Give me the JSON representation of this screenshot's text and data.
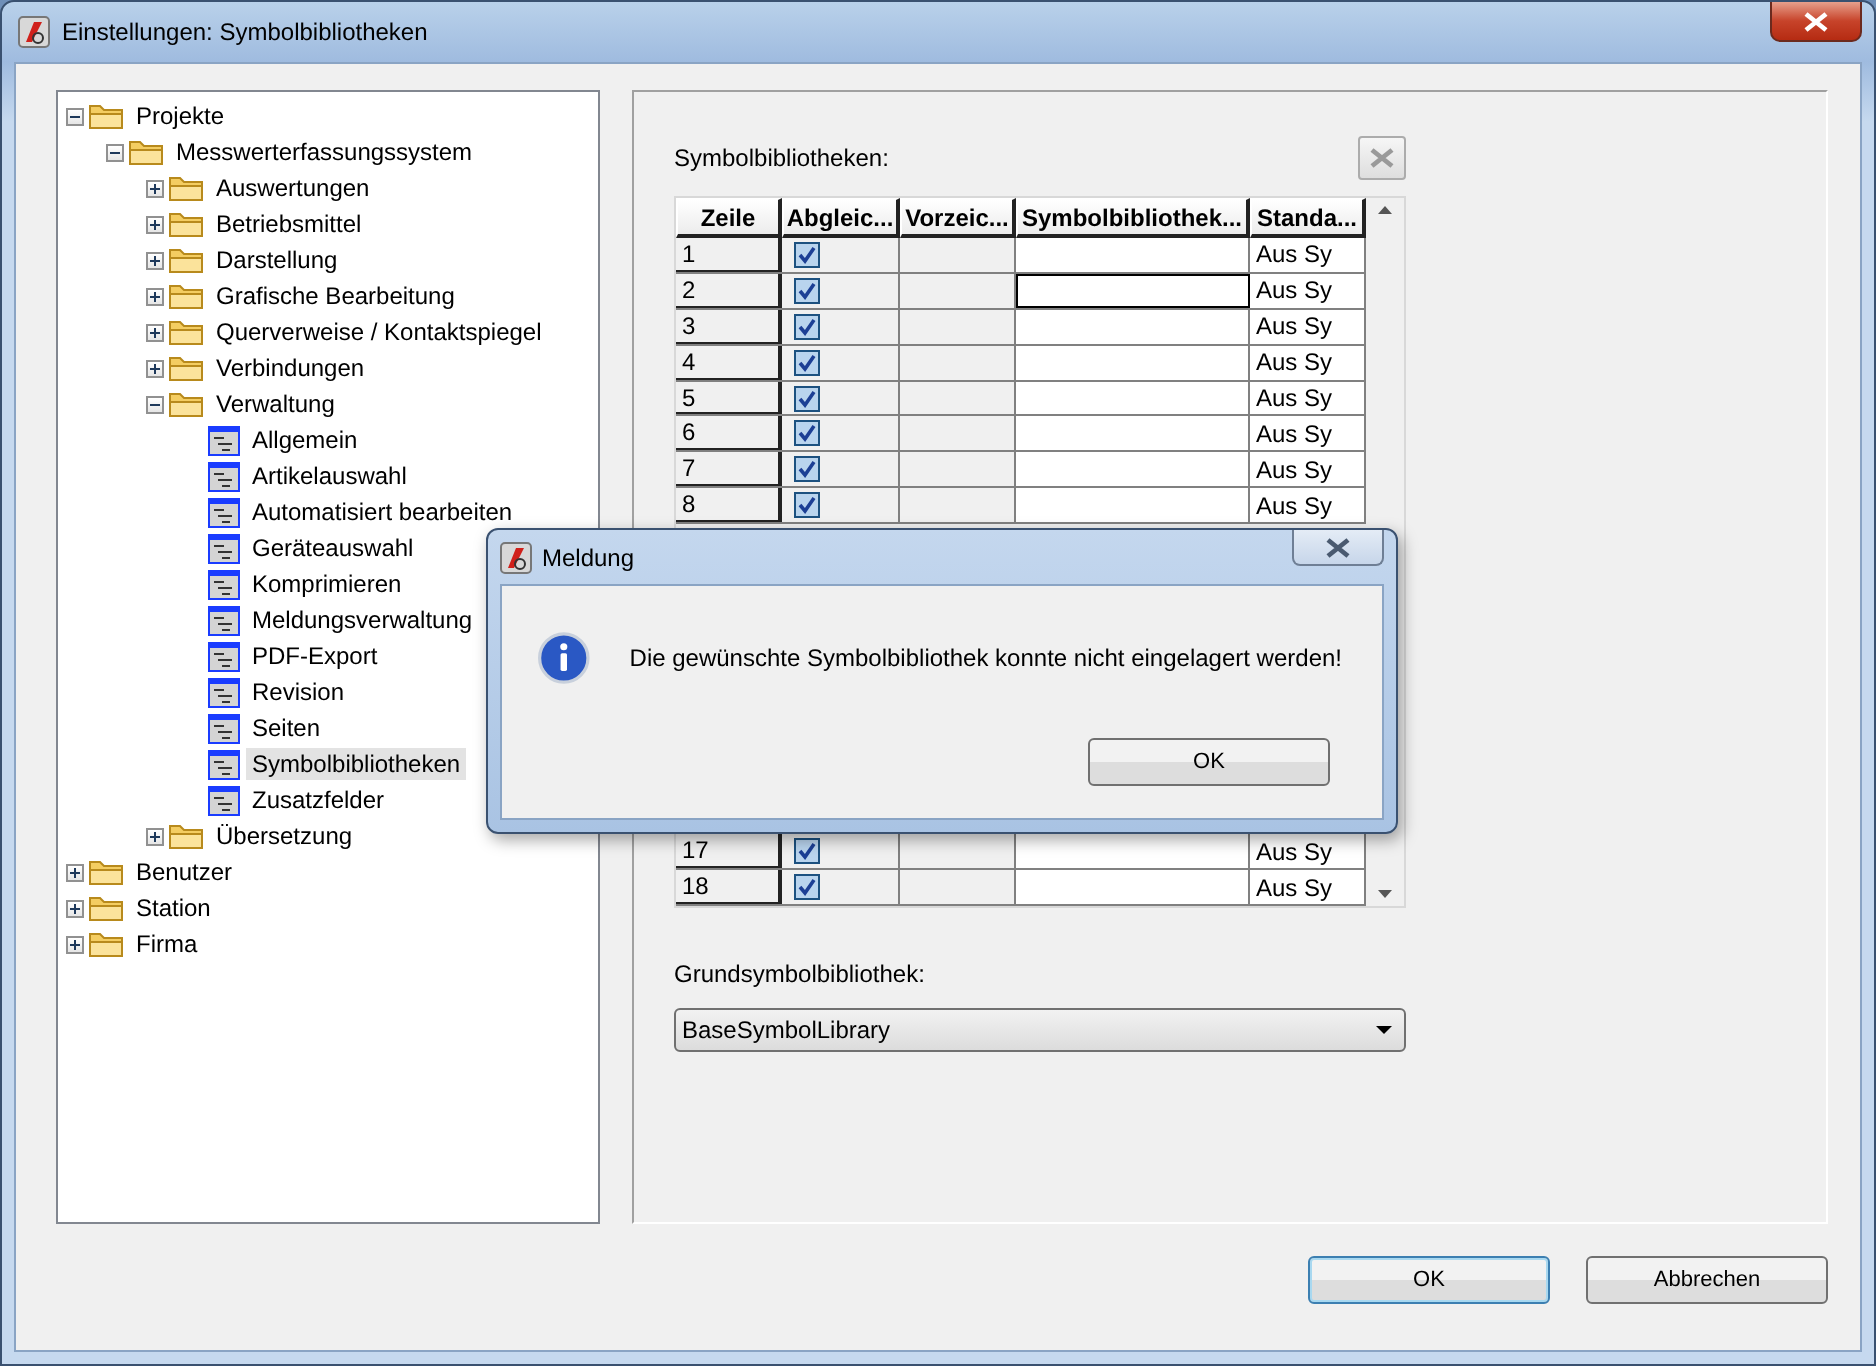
{
  "window": {
    "title": "Einstellungen: Symbolbibliotheken"
  },
  "tree": [
    {
      "label": "Projekte",
      "kind": "folder",
      "expanded": true,
      "selected": false,
      "children": [
        {
          "label": "Messwerterfassungssystem",
          "kind": "folder",
          "expanded": true,
          "selected": false,
          "children": [
            {
              "label": "Auswertungen",
              "kind": "folder",
              "expanded": false,
              "selected": false
            },
            {
              "label": "Betriebsmittel",
              "kind": "folder",
              "expanded": false,
              "selected": false
            },
            {
              "label": "Darstellung",
              "kind": "folder",
              "expanded": false,
              "selected": false
            },
            {
              "label": "Grafische Bearbeitung",
              "kind": "folder",
              "expanded": false,
              "selected": false
            },
            {
              "label": "Querverweise / Kontaktspiegel",
              "kind": "folder",
              "expanded": false,
              "selected": false
            },
            {
              "label": "Verbindungen",
              "kind": "folder",
              "expanded": false,
              "selected": false
            },
            {
              "label": "Verwaltung",
              "kind": "folder",
              "expanded": true,
              "selected": false,
              "children": [
                {
                  "label": "Allgemein",
                  "kind": "page",
                  "selected": false
                },
                {
                  "label": "Artikelauswahl",
                  "kind": "page",
                  "selected": false
                },
                {
                  "label": "Automatisiert bearbeiten",
                  "kind": "page",
                  "selected": false
                },
                {
                  "label": "Geräteauswahl",
                  "kind": "page",
                  "selected": false
                },
                {
                  "label": "Komprimieren",
                  "kind": "page",
                  "selected": false
                },
                {
                  "label": "Meldungsverwaltung",
                  "kind": "page",
                  "selected": false
                },
                {
                  "label": "PDF-Export",
                  "kind": "page",
                  "selected": false
                },
                {
                  "label": "Revision",
                  "kind": "page",
                  "selected": false
                },
                {
                  "label": "Seiten",
                  "kind": "page",
                  "selected": false
                },
                {
                  "label": "Symbolbibliotheken",
                  "kind": "page",
                  "selected": true
                },
                {
                  "label": "Zusatzfelder",
                  "kind": "page",
                  "selected": false
                }
              ]
            },
            {
              "label": "Übersetzung",
              "kind": "folder",
              "expanded": false,
              "selected": false
            }
          ]
        }
      ]
    },
    {
      "label": "Benutzer",
      "kind": "folder",
      "expanded": false,
      "selected": false
    },
    {
      "label": "Station",
      "kind": "folder",
      "expanded": false,
      "selected": false
    },
    {
      "label": "Firma",
      "kind": "folder",
      "expanded": false,
      "selected": false
    }
  ],
  "libraries": {
    "label": "Symbolbibliotheken:",
    "columns": [
      "Zeile",
      "Abgleic...",
      "Vorzeic...",
      "Symbolbibliothek...",
      "Standa..."
    ],
    "rows": [
      {
        "row": "1",
        "checked": true,
        "editing": false,
        "default": "Aus Sy"
      },
      {
        "row": "2",
        "checked": true,
        "editing": true,
        "default": "Aus Sy"
      },
      {
        "row": "3",
        "checked": true,
        "editing": false,
        "default": "Aus Sy"
      },
      {
        "row": "4",
        "checked": true,
        "editing": false,
        "default": "Aus Sy"
      },
      {
        "row": "5",
        "checked": true,
        "editing": false,
        "default": "Aus Sy"
      },
      {
        "row": "6",
        "checked": true,
        "editing": false,
        "default": "Aus Sy"
      },
      {
        "row": "7",
        "checked": true,
        "editing": false,
        "default": "Aus Sy"
      },
      {
        "row": "8",
        "checked": true,
        "editing": false,
        "default": "Aus Sy"
      }
    ],
    "rows_after_dialog": [
      {
        "row": "17",
        "checked": true,
        "editing": false,
        "default": "Aus Sy"
      },
      {
        "row": "18",
        "checked": true,
        "editing": false,
        "default": "Aus Sy"
      }
    ]
  },
  "base_library": {
    "label": "Grundsymbolbibliothek:",
    "value": "BaseSymbolLibrary"
  },
  "buttons": [
    {
      "label": "OK",
      "default": true
    },
    {
      "label": "Abbrechen",
      "default": false
    }
  ],
  "dialog": {
    "title": "Meldung",
    "message": "Die gewünschte Symbolbibliothek konnte nicht eingelagert werden!",
    "button": "OK"
  }
}
